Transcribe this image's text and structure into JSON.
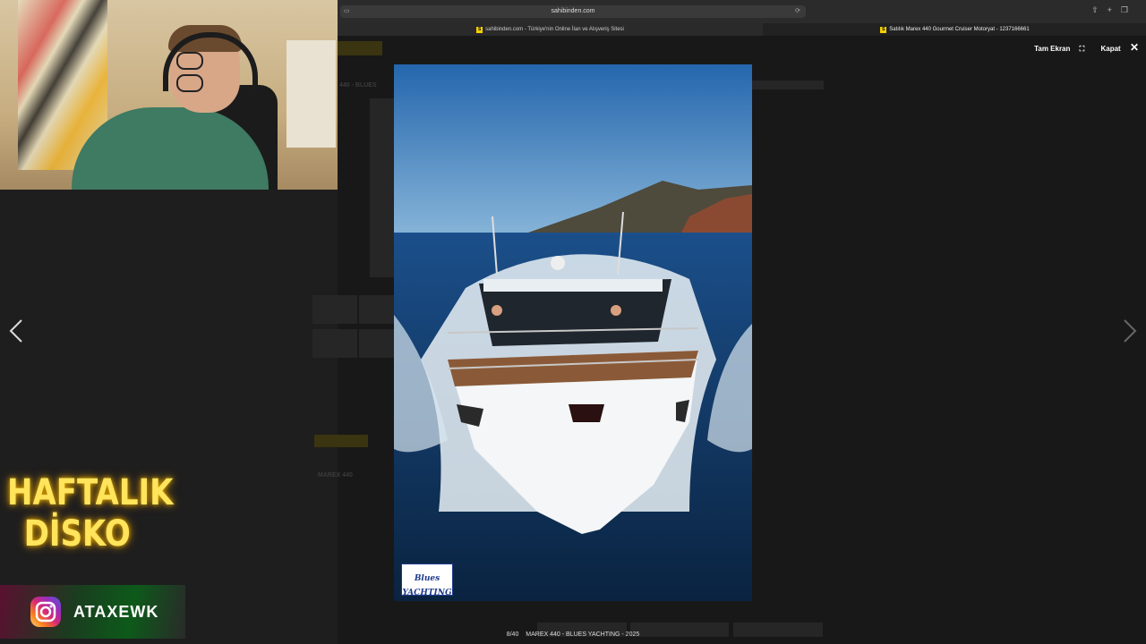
{
  "browser": {
    "url": "sahibinden.com",
    "tabs": [
      {
        "label": "sahibinden.com - Türkiye'nin Online İlan ve Alışveriş Sitesi",
        "favicon": "S"
      },
      {
        "label": "Satılık Marex 440 Gourmet Cruiser Motoryat - 1237166661",
        "favicon": "S"
      }
    ]
  },
  "lightbox": {
    "fullscreen_label": "Tam Ekran",
    "close_label": "Kapat",
    "counter": "8/40",
    "title": "MAREX 440 - BLUES YACHTING - 2025",
    "watermark": "Blues YACHTING"
  },
  "background_page": {
    "brand": "sahibinden.com",
    "model_heading": "MAREX 440",
    "listing_heading": "440 - BLUES"
  },
  "overlay": {
    "show_title_line1": "HAFTALIK",
    "show_title_line2": "DİSKO",
    "instagram_handle": "ATAXEWK"
  },
  "icons": [
    "fullscreen-icon",
    "close-icon",
    "chevron-left-icon",
    "chevron-right-icon",
    "instagram-icon",
    "reload-icon",
    "share-icon",
    "new-tab-icon",
    "tabs-icon"
  ],
  "colors": {
    "accent_yellow": "#ffe45c",
    "sahibinden_yellow": "#f5d000",
    "sky": "#2f6fb0",
    "sea": "#123b6b"
  }
}
